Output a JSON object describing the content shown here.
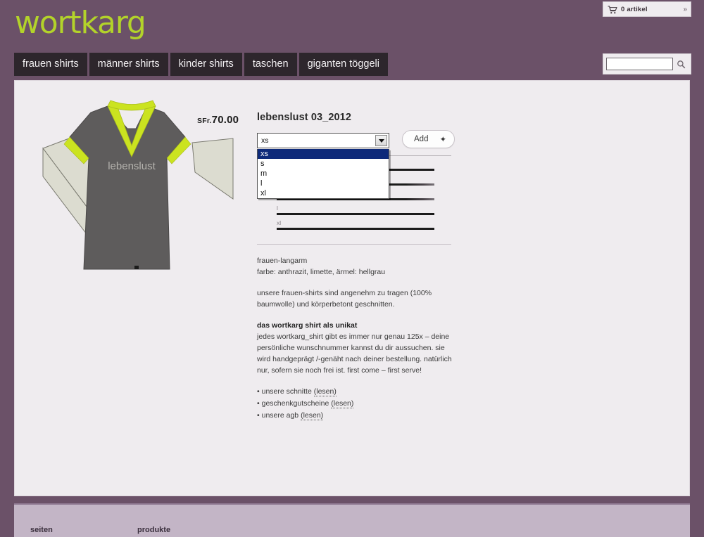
{
  "brand": {
    "logo_text": "wortkarg",
    "logo_color": "#b3d32a"
  },
  "theme": {
    "background": "#6b5168",
    "panel": "#efecef",
    "nav_item_bg": "#2d262c",
    "footer_bg": "#c3b5c6",
    "highlight": "#0e2a7a"
  },
  "topbar": {
    "cart_icon": "shopping-cart-icon",
    "cart_label": "0 artikel",
    "cart_expand": "»"
  },
  "nav": {
    "items": [
      {
        "label": "frauen shirts"
      },
      {
        "label": "männer shirts"
      },
      {
        "label": "kinder shirts"
      },
      {
        "label": "taschen"
      },
      {
        "label": "giganten töggeli"
      }
    ]
  },
  "search": {
    "value": "",
    "placeholder": "",
    "icon": "magnifier-icon"
  },
  "product": {
    "title": "lebenslust 03_2012",
    "shirt_print": "lebenslust",
    "price_currency": "SFr.",
    "price_amount": "70.00",
    "size_select": {
      "selected": "xs",
      "options": [
        {
          "label": "xs",
          "selected": true
        },
        {
          "label": "s",
          "selected": false
        },
        {
          "label": "m",
          "selected": false
        },
        {
          "label": "l",
          "selected": false
        },
        {
          "label": "xl",
          "selected": false
        }
      ]
    },
    "add_button": {
      "label": "Add",
      "plus": "✦"
    },
    "stock_rows": [
      {
        "label": "xs",
        "fill": 100
      },
      {
        "label": "s",
        "fill": 82
      },
      {
        "label": "m",
        "fill": 88
      },
      {
        "label": "l",
        "fill": 100
      },
      {
        "label": "xl",
        "fill": 100
      }
    ],
    "description": {
      "line1": "frauen-langarm",
      "line2": "farbe: anthrazit, limette, ärmel: hellgrau",
      "para1": "unsere frauen-shirts sind angenehm zu tragen (100% baumwolle) und körperbetont geschnitten.",
      "heading": "das wortkarg shirt als unikat",
      "para2": "jedes wortkarg_shirt gibt es immer nur genau 125x – deine persönliche wunschnummer kannst du dir aussuchen. sie wird handgeprägt /-genäht nach deiner bestellung. natürlich nur, sofern sie noch frei ist. first come – first serve!"
    },
    "links": [
      {
        "bullet": "•",
        "text": "unsere schnitte",
        "link": "(lesen)"
      },
      {
        "bullet": "•",
        "text": "geschenkgutscheine",
        "link": "(lesen)"
      },
      {
        "bullet": "•",
        "text": "unsere agb",
        "link": "(lesen)"
      }
    ]
  },
  "footer": {
    "col1": "seiten",
    "col2": "produkte"
  }
}
